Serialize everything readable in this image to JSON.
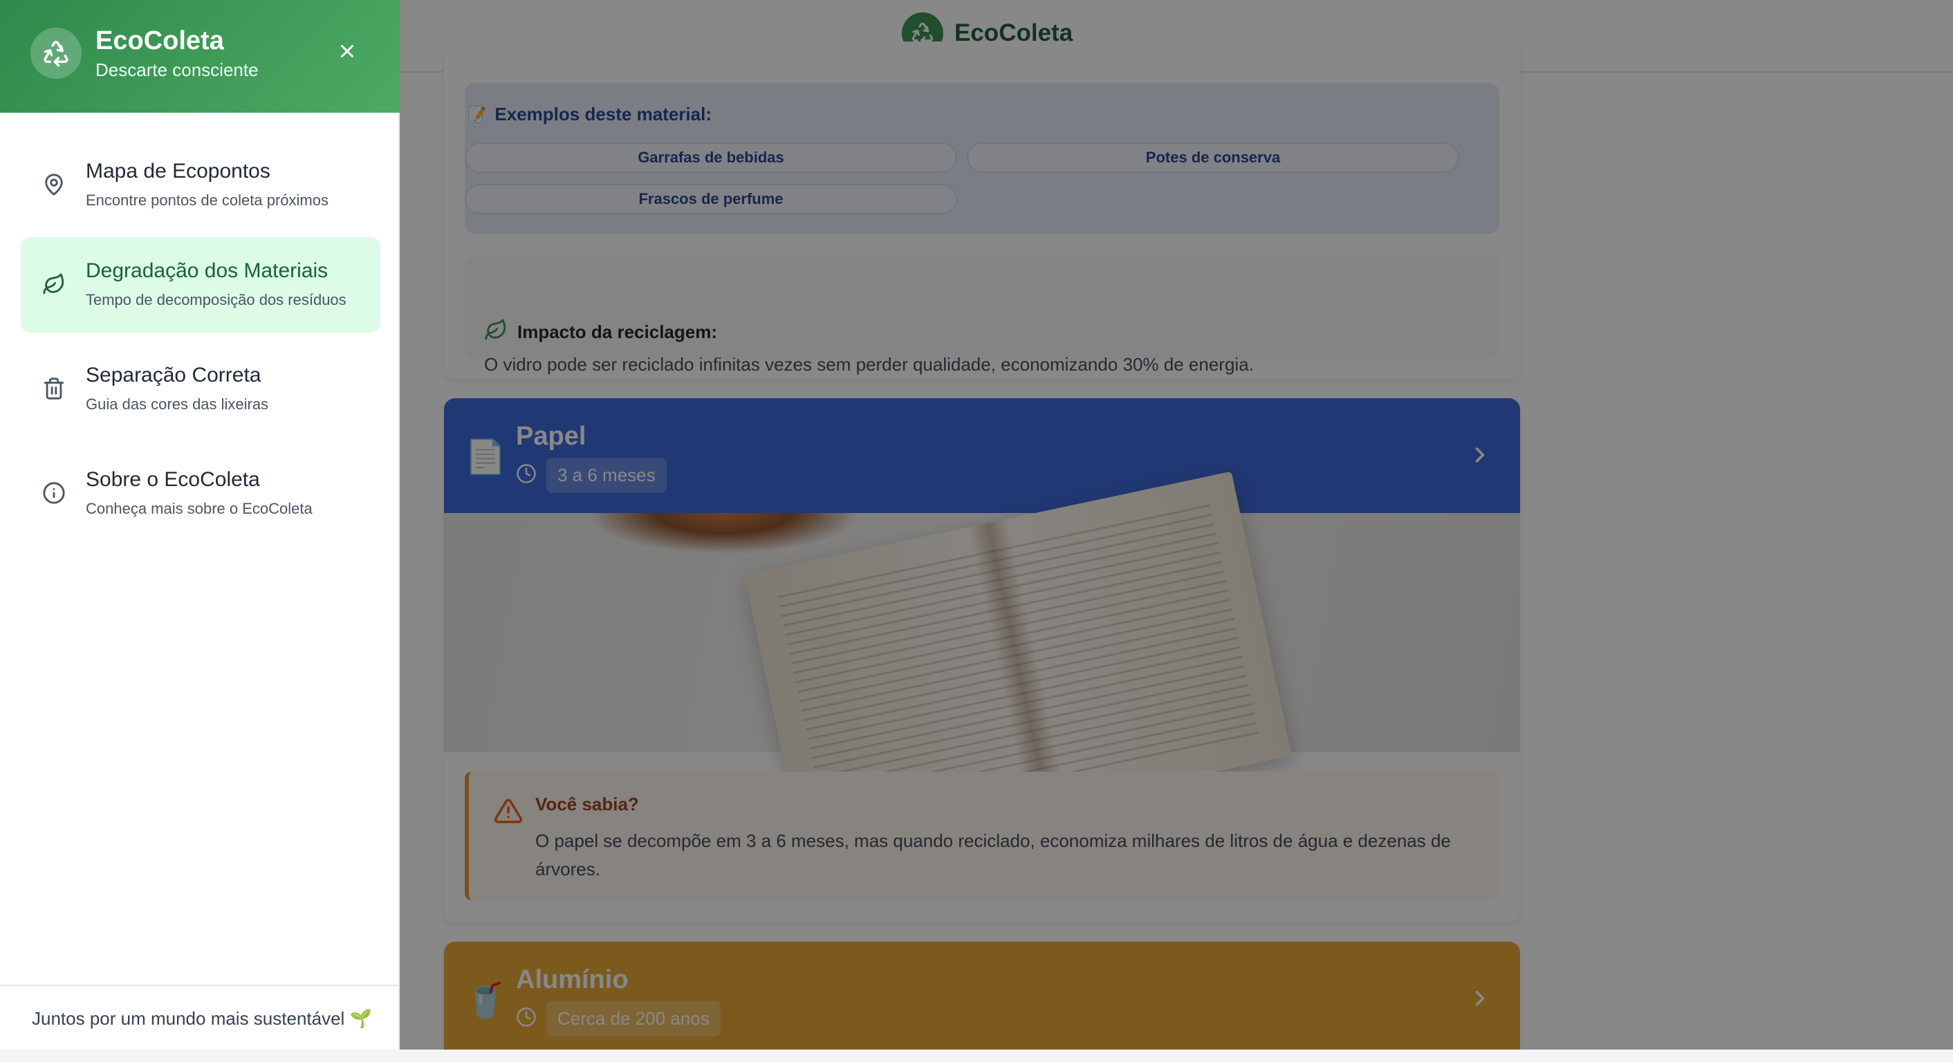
{
  "app": {
    "name": "EcoColeta"
  },
  "drawer": {
    "title": "EcoColeta",
    "subtitle": "Descarte consciente",
    "items": [
      {
        "label": "Mapa de Ecopontos",
        "desc": "Encontre pontos de coleta próximos",
        "icon": "map-pin-icon"
      },
      {
        "label": "Degradação dos Materiais",
        "desc": "Tempo de decomposição dos resíduos",
        "icon": "leaf-icon",
        "active": true
      },
      {
        "label": "Separação Correta",
        "desc": "Guia das cores das lixeiras",
        "icon": "trash-icon"
      },
      {
        "label": "Sobre o EcoColeta",
        "desc": "Conheça mais sobre o EcoColeta",
        "icon": "info-icon"
      }
    ],
    "footer": "Juntos por um mundo mais sustentável 🌱"
  },
  "glass": {
    "examples_title": "Exemplos deste material:",
    "examples": [
      "Garrafas de bebidas",
      "Potes de conserva",
      "Frascos de perfume"
    ],
    "impact_title": "Impacto da reciclagem:",
    "impact_text": "O vidro pode ser reciclado infinitas vezes sem perder qualidade, economizando 30% de energia."
  },
  "paper": {
    "emoji": "📄",
    "title": "Papel",
    "time": "3 a 6 meses",
    "tip_title": "Você sabia?",
    "tip_text": "O papel se decompõe em 3 a 6 meses, mas quando reciclado, economiza milhares de litros de água e dezenas de árvores."
  },
  "aluminum": {
    "emoji": "🥤",
    "title": "Alumínio",
    "time": "Cerca de 200 anos"
  },
  "colors": {
    "brand_green": "#2f8a4b",
    "paper_blue": "#2f5fd6",
    "aluminum_amber": "#e7a32a",
    "active_nav_bg": "#dcfce7"
  }
}
